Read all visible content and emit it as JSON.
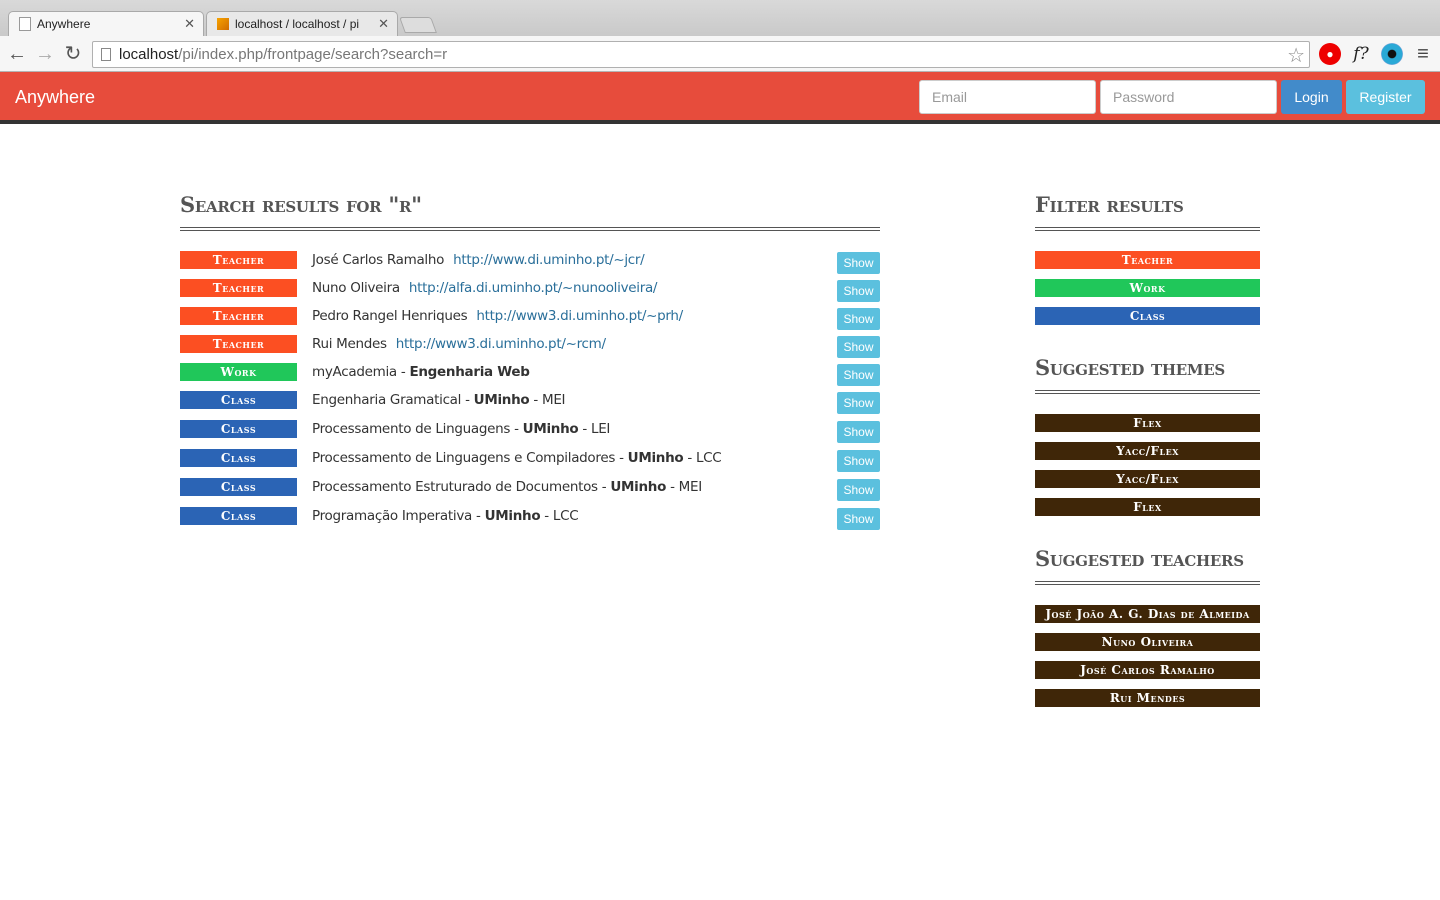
{
  "browser": {
    "tabs": [
      {
        "title": "Anywhere"
      },
      {
        "title": "localhost / localhost / pi"
      }
    ],
    "url_host": "localhost",
    "url_path": "/pi/index.php/frontpage/search?search=r"
  },
  "navbar": {
    "brand": "Anywhere",
    "email_placeholder": "Email",
    "password_placeholder": "Password",
    "login_label": "Login",
    "register_label": "Register"
  },
  "search": {
    "title": "Search results for \"r\"",
    "show_label": "Show",
    "results": [
      {
        "type": "Teacher",
        "name": "José Carlos Ramalho",
        "link": "http://www.di.uminho.pt/~jcr/"
      },
      {
        "type": "Teacher",
        "name": "Nuno Oliveira",
        "link": "http://alfa.di.uminho.pt/~nunooliveira/"
      },
      {
        "type": "Teacher",
        "name": "Pedro Rangel Henriques",
        "link": "http://www3.di.uminho.pt/~prh/"
      },
      {
        "type": "Teacher",
        "name": "Rui Mendes",
        "link": "http://www3.di.uminho.pt/~rcm/"
      },
      {
        "type": "Work",
        "name": "myAcademia",
        "sep": " - ",
        "org": "Engenharia Web"
      },
      {
        "type": "Class",
        "name": "Engenharia Gramatical",
        "sep": " - ",
        "org": "UMinho",
        "sep2": " - ",
        "course": "MEI"
      },
      {
        "type": "Class",
        "name": "Processamento de Linguagens",
        "sep": " - ",
        "org": "UMinho",
        "sep2": " - ",
        "course": "LEI"
      },
      {
        "type": "Class",
        "name": "Processamento de Linguagens e Compiladores",
        "sep": " - ",
        "org": "UMinho",
        "sep2": " - ",
        "course": "LCC"
      },
      {
        "type": "Class",
        "name": "Processamento Estruturado de Documentos",
        "sep": " - ",
        "org": "UMinho",
        "sep2": " - ",
        "course": "MEI"
      },
      {
        "type": "Class",
        "name": "Programação Imperativa",
        "sep": " - ",
        "org": "UMinho",
        "sep2": " - ",
        "course": "LCC"
      }
    ]
  },
  "filter": {
    "title": "Filter results",
    "items": [
      "Teacher",
      "Work",
      "Class"
    ]
  },
  "themes": {
    "title": "Suggested themes",
    "items": [
      "Flex",
      "Yacc/Flex",
      "Yacc/Flex",
      "Flex"
    ]
  },
  "teachers": {
    "title": "Suggested teachers",
    "items": [
      "José João A. G. Dias de Almeida",
      "Nuno Oliveira",
      "José Carlos Ramalho",
      "Rui Mendes"
    ]
  },
  "colors": {
    "navbar": "#e74c3c",
    "teacher": "#fc4f22",
    "work": "#20c75a",
    "class": "#2b64b5",
    "suggestion": "#3f2608",
    "show_button": "#5bc0de",
    "login_button": "#428bca"
  }
}
